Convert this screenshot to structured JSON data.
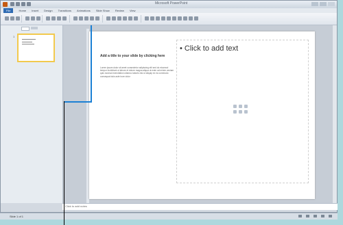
{
  "window": {
    "title": "Microsoft PowerPoint"
  },
  "ribbon": {
    "tabs": [
      "File",
      "Home",
      "Insert",
      "Design",
      "Transitions",
      "Animations",
      "Slide Show",
      "Review",
      "View"
    ]
  },
  "slides_pane": {
    "thumbnail_number": "1"
  },
  "slide": {
    "title_text": "Add a title to your slide by clicking here",
    "body_text": "Lorem ipsum dolor sit amet consectetur adipiscing elit sed do eiusmod tempor incididunt ut labore et dolore magna aliqua ut enim ad minim veniam quis nostrud exercitation ullamco laboris nisi ut aliquip ex ea commodo consequat duis aute irure dolor",
    "content_placeholder": "Click to add text"
  },
  "notes": {
    "placeholder": "Click to add notes"
  },
  "status": {
    "slide_info": "Slide 1 of 1"
  },
  "colors": {
    "callout": "#1a7fd4",
    "selection": "#f2c94c",
    "file_tab": "#2f6bb3"
  }
}
